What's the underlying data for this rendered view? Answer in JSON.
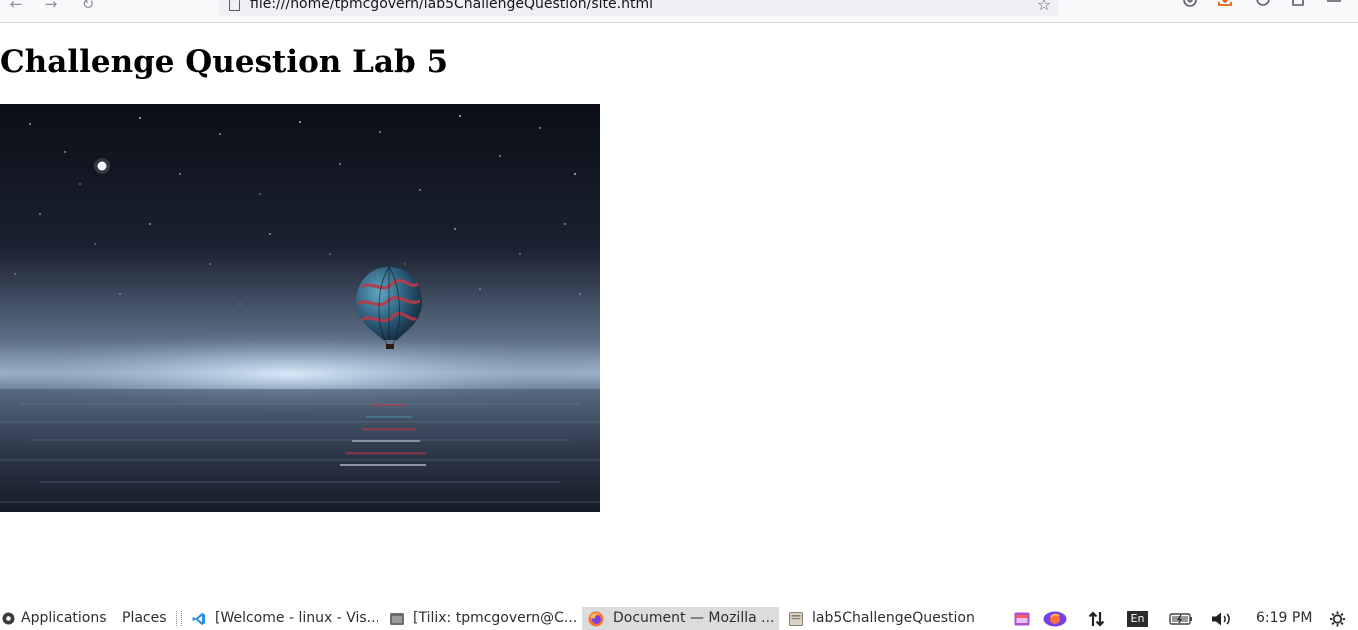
{
  "browser": {
    "url": "file:///home/tpmcgovern/lab5ChallengeQuestion/site.html",
    "icons": {
      "back": "back-arrow-icon",
      "forward": "forward-arrow-icon",
      "reload": "reload-icon",
      "bookmark": "star-icon",
      "pocket": "pocket-icon",
      "downloads": "download-icon",
      "account": "account-icon",
      "extensions": "extensions-icon",
      "menu": "hamburger-menu-icon"
    },
    "accent_download": "#e2620f"
  },
  "page": {
    "heading": "Challenge Question Lab 5",
    "image": {
      "description_icon": "hot-air-balloon-night-sea-image"
    }
  },
  "taskbar": {
    "applications_label": "Applications",
    "places_label": "Places",
    "windows": [
      {
        "label": "[Welcome - linux - Vis...",
        "icon": "vscode-icon",
        "active": false
      },
      {
        "label": "[Tilix: tpmcgovern@C...",
        "icon": "terminal-icon",
        "active": false
      },
      {
        "label": "Document — Mozilla ...",
        "icon": "firefox-icon",
        "active": true
      },
      {
        "label": "lab5ChallengeQuestion",
        "icon": "folder-icon",
        "active": false
      }
    ],
    "tray": {
      "keyboard_layout": "En",
      "clock": "6:19 PM"
    }
  }
}
